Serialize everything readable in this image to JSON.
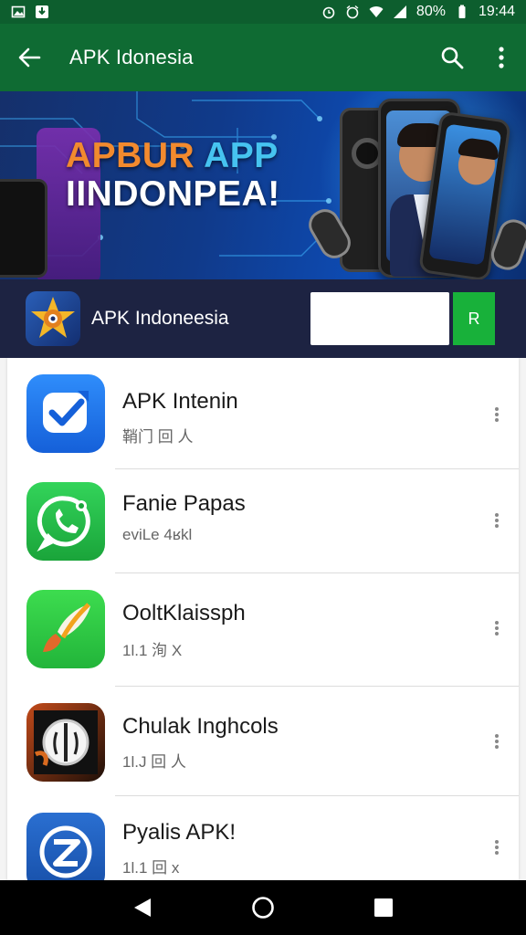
{
  "status_bar": {
    "battery": "80%",
    "time": "19:44",
    "icons": [
      "image-icon",
      "download-icon",
      "alarm-icon",
      "alarm-icon",
      "wifi-icon",
      "signal-icon",
      "battery-icon"
    ]
  },
  "app_bar": {
    "title": "APK Idonesia",
    "icons": [
      "back-arrow-icon",
      "search-icon",
      "more-vert-icon"
    ]
  },
  "banner": {
    "headline_line1_a": "APBUR",
    "headline_line1_b": "APP",
    "headline_line2": "IINDONPEA!"
  },
  "featured": {
    "name": "APK Indoneesia",
    "input_value": "",
    "button_label": "R",
    "accent": "#18b13a"
  },
  "apps": [
    {
      "name": "APK Intenin",
      "subtitle": "鞘门 回 人",
      "icon": "check-bubble-icon"
    },
    {
      "name": "Fanie Papas",
      "subtitle": "eviLe 4ʁkl",
      "icon": "chat-phone-icon"
    },
    {
      "name": "OoltKlaissph",
      "subtitle": "1l.1 洵 X",
      "icon": "brush-icon"
    },
    {
      "name": "Chulak Inghcols",
      "subtitle": "1l.J 回 人",
      "icon": "target-icon"
    },
    {
      "name": "Pyalis APK!",
      "subtitle": "1l.1 回 x",
      "icon": "z-logo-icon"
    }
  ],
  "nav": [
    "back-triangle-icon",
    "home-circle-icon",
    "recents-square-icon"
  ],
  "colors": {
    "status_bar": "#0d5e2e",
    "app_bar": "#0f6b33",
    "strip": "#1d2342",
    "install": "#18b13a"
  }
}
